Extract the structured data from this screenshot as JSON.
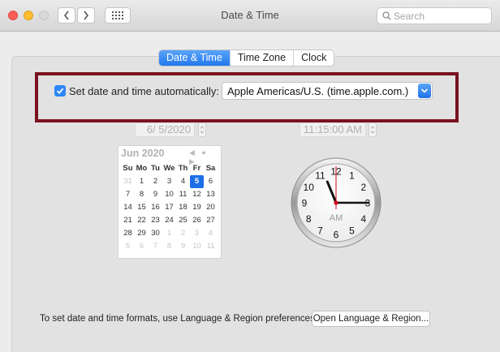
{
  "window": {
    "title": "Date & Time",
    "search_placeholder": "Search"
  },
  "tabs": [
    {
      "label": "Date & Time",
      "active": true
    },
    {
      "label": "Time Zone",
      "active": false
    },
    {
      "label": "Clock",
      "active": false
    }
  ],
  "auto_setting": {
    "label": "Set date and time automatically:",
    "checked": true,
    "server": "Apple Americas/U.S. (time.apple.com.)"
  },
  "date_field": "6/  5/2020",
  "time_field": "11:15:00 AM",
  "calendar": {
    "month_label": "Jun 2020",
    "nav": "◀ ● ▶",
    "weekdays": [
      "Su",
      "Mo",
      "Tu",
      "We",
      "Th",
      "Fr",
      "Sa"
    ],
    "weeks": [
      [
        "31",
        "1",
        "2",
        "3",
        "4",
        "5",
        "6"
      ],
      [
        "7",
        "8",
        "9",
        "10",
        "11",
        "12",
        "13"
      ],
      [
        "14",
        "15",
        "16",
        "17",
        "18",
        "19",
        "20"
      ],
      [
        "21",
        "22",
        "23",
        "24",
        "25",
        "26",
        "27"
      ],
      [
        "28",
        "29",
        "30",
        "1",
        "2",
        "3",
        "4"
      ],
      [
        "5",
        "6",
        "7",
        "8",
        "9",
        "10",
        "11"
      ]
    ],
    "selected_day": "5"
  },
  "clock": {
    "numbers": [
      "12",
      "1",
      "2",
      "3",
      "4",
      "5",
      "6",
      "7",
      "8",
      "9",
      "10",
      "11"
    ],
    "period": "AM",
    "hour": 11,
    "minute": 15,
    "second": 0
  },
  "footer": {
    "text": "To set date and time formats, use Language & Region preferences.",
    "button_label": "Open Language & Region..."
  },
  "colors": {
    "accent": "#2278ed",
    "highlight_border": "#7a1220",
    "second_hand": "#d0021b"
  }
}
